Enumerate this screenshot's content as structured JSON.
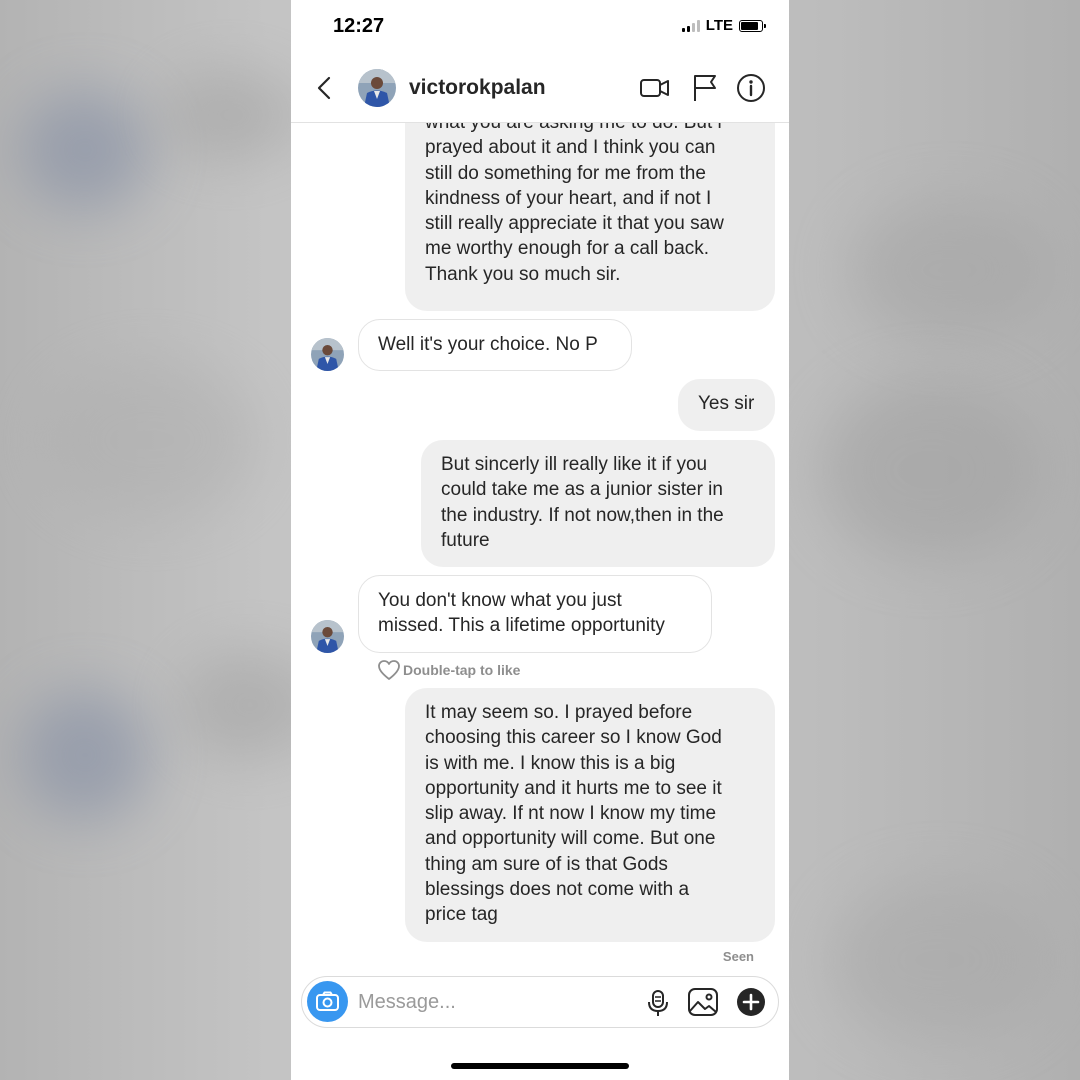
{
  "status_bar": {
    "time": "12:27",
    "network": "LTE"
  },
  "header": {
    "username": "victorokpalan"
  },
  "messages": [
    {
      "direction": "outgoing",
      "text": "what you are asking me to do. But i\nprayed about it and I think you can\nstill do something for me from the\nkindness of your heart, and if not I\nstill really appreciate it that you saw\nme worthy enough for a call back.\nThank you so much sir."
    },
    {
      "direction": "incoming",
      "text": "Well it's your choice. No P"
    },
    {
      "direction": "outgoing",
      "text": "Yes sir"
    },
    {
      "direction": "outgoing",
      "text": "But sincerly ill really like it if you\ncould take me as a junior sister in\nthe industry. If not now,then in the\nfuture"
    },
    {
      "direction": "incoming",
      "text": "You don't know what you just\nmissed. This a lifetime opportunity"
    },
    {
      "direction": "outgoing",
      "text": "It may seem so. I prayed before\nchoosing this career so I know God\nis with me. I know this is a big\nopportunity and it hurts me to see it\nslip away. If nt now I know my time\nand opportunity will come. But one\nthing am sure of is that Gods\nblessings does not come with a\nprice tag"
    }
  ],
  "like_hint": "Double-tap to like",
  "seen_label": "Seen",
  "composer": {
    "placeholder": "Message..."
  },
  "colors": {
    "accent": "#3897f0",
    "bubble_outgoing": "#efefef",
    "text": "#262626",
    "muted": "#8e8e8e"
  },
  "icons": [
    "back-chevron-icon",
    "video-call-icon",
    "flag-icon",
    "info-icon",
    "camera-icon",
    "microphone-icon",
    "gallery-icon",
    "plus-icon",
    "heart-icon"
  ]
}
